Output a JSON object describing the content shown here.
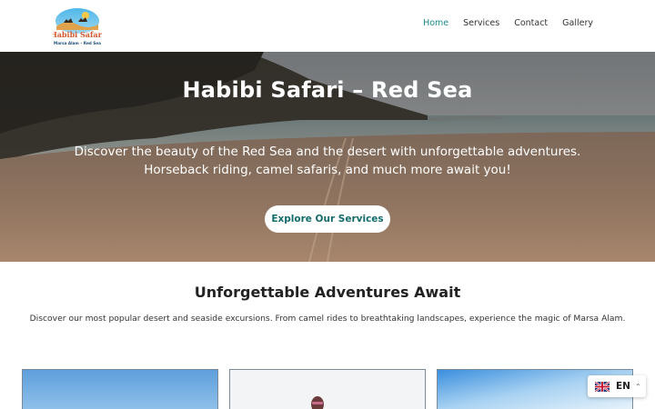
{
  "header": {
    "logo": {
      "title": "Habibi Safari",
      "subtitle": "Marsa Alam – Red Sea"
    },
    "nav": [
      {
        "label": "Home",
        "active": true
      },
      {
        "label": "Services",
        "active": false
      },
      {
        "label": "Contact",
        "active": false
      },
      {
        "label": "Gallery",
        "active": false
      }
    ]
  },
  "hero": {
    "title": "Habibi Safari – Red Sea",
    "description": "Discover the beauty of the Red Sea and the desert with unforgettable adventures. Horseback riding, camel safaris, and much more await you!",
    "button_label": "Explore Our Services"
  },
  "section": {
    "title": "Unforgettable Adventures Await",
    "description": "Discover our most popular desert and seaside excursions. From camel rides to breathtaking landscapes, experience the magic of Marsa Alam."
  },
  "language_switcher": {
    "code": "EN",
    "icon": "uk-flag-icon"
  },
  "colors": {
    "accent": "#1f8a8a",
    "button_text": "#136b6b"
  }
}
